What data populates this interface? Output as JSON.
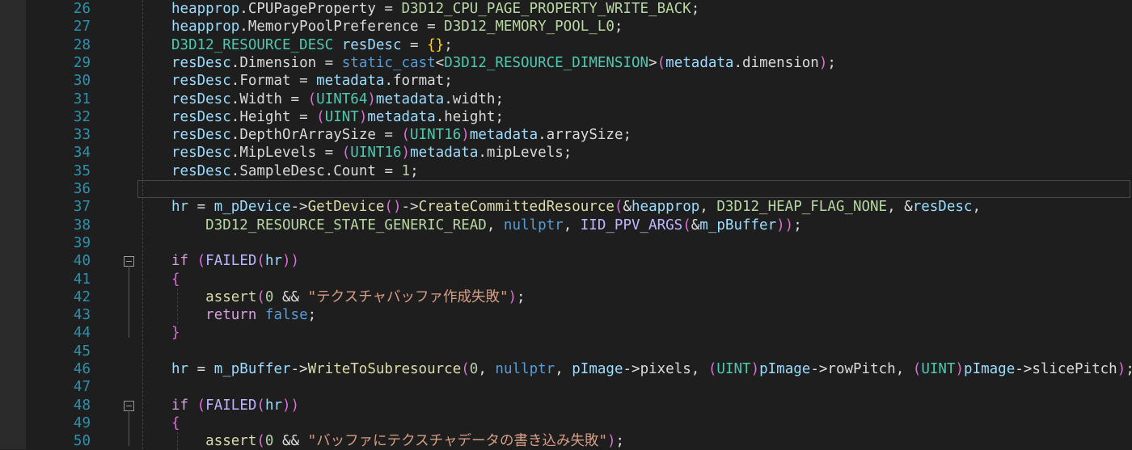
{
  "editor": {
    "line_numbers": [
      "26",
      "27",
      "28",
      "29",
      "30",
      "31",
      "32",
      "33",
      "34",
      "35",
      "36",
      "37",
      "38",
      "39",
      "40",
      "41",
      "42",
      "43",
      "44",
      "45",
      "46",
      "47",
      "48",
      "49",
      "50"
    ],
    "lines": [
      [
        [
          "t-var",
          "heapprop"
        ],
        [
          "t-plain",
          "."
        ],
        [
          "t-mem",
          "CPUPageProperty"
        ],
        [
          "t-plain",
          " = "
        ],
        [
          "t-enum",
          "D3D12_CPU_PAGE_PROPERTY_WRITE_BACK"
        ],
        [
          "t-plain",
          ";"
        ]
      ],
      [
        [
          "t-var",
          "heapprop"
        ],
        [
          "t-plain",
          "."
        ],
        [
          "t-mem",
          "MemoryPoolPreference"
        ],
        [
          "t-plain",
          " = "
        ],
        [
          "t-enum",
          "D3D12_MEMORY_POOL_L0"
        ],
        [
          "t-plain",
          ";"
        ]
      ],
      [
        [
          "t-type",
          "D3D12_RESOURCE_DESC"
        ],
        [
          "t-plain",
          " "
        ],
        [
          "t-var",
          "resDesc"
        ],
        [
          "t-plain",
          " = "
        ],
        [
          "t-brace",
          "{}"
        ],
        [
          "t-plain",
          ";"
        ]
      ],
      [
        [
          "t-var",
          "resDesc"
        ],
        [
          "t-plain",
          "."
        ],
        [
          "t-mem",
          "Dimension"
        ],
        [
          "t-plain",
          " = "
        ],
        [
          "t-kw",
          "static_cast"
        ],
        [
          "t-plain",
          "<"
        ],
        [
          "t-type",
          "D3D12_RESOURCE_DIMENSION"
        ],
        [
          "t-plain",
          ">"
        ],
        [
          "t-paren",
          "("
        ],
        [
          "t-var",
          "metadata"
        ],
        [
          "t-plain",
          "."
        ],
        [
          "t-mem",
          "dimension"
        ],
        [
          "t-paren",
          ")"
        ],
        [
          "t-plain",
          ";"
        ]
      ],
      [
        [
          "t-var",
          "resDesc"
        ],
        [
          "t-plain",
          "."
        ],
        [
          "t-mem",
          "Format"
        ],
        [
          "t-plain",
          " = "
        ],
        [
          "t-var",
          "metadata"
        ],
        [
          "t-plain",
          "."
        ],
        [
          "t-mem",
          "format"
        ],
        [
          "t-plain",
          ";"
        ]
      ],
      [
        [
          "t-var",
          "resDesc"
        ],
        [
          "t-plain",
          "."
        ],
        [
          "t-mem",
          "Width"
        ],
        [
          "t-plain",
          " = "
        ],
        [
          "t-paren",
          "("
        ],
        [
          "t-type",
          "UINT64"
        ],
        [
          "t-paren",
          ")"
        ],
        [
          "t-var",
          "metadata"
        ],
        [
          "t-plain",
          "."
        ],
        [
          "t-mem",
          "width"
        ],
        [
          "t-plain",
          ";"
        ]
      ],
      [
        [
          "t-var",
          "resDesc"
        ],
        [
          "t-plain",
          "."
        ],
        [
          "t-mem",
          "Height"
        ],
        [
          "t-plain",
          " = "
        ],
        [
          "t-paren",
          "("
        ],
        [
          "t-type",
          "UINT"
        ],
        [
          "t-paren",
          ")"
        ],
        [
          "t-var",
          "metadata"
        ],
        [
          "t-plain",
          "."
        ],
        [
          "t-mem",
          "height"
        ],
        [
          "t-plain",
          ";"
        ]
      ],
      [
        [
          "t-var",
          "resDesc"
        ],
        [
          "t-plain",
          "."
        ],
        [
          "t-mem",
          "DepthOrArraySize"
        ],
        [
          "t-plain",
          " = "
        ],
        [
          "t-paren",
          "("
        ],
        [
          "t-type",
          "UINT16"
        ],
        [
          "t-paren",
          ")"
        ],
        [
          "t-var",
          "metadata"
        ],
        [
          "t-plain",
          "."
        ],
        [
          "t-mem",
          "arraySize"
        ],
        [
          "t-plain",
          ";"
        ]
      ],
      [
        [
          "t-var",
          "resDesc"
        ],
        [
          "t-plain",
          "."
        ],
        [
          "t-mem",
          "MipLevels"
        ],
        [
          "t-plain",
          " = "
        ],
        [
          "t-paren",
          "("
        ],
        [
          "t-type",
          "UINT16"
        ],
        [
          "t-paren",
          ")"
        ],
        [
          "t-var",
          "metadata"
        ],
        [
          "t-plain",
          "."
        ],
        [
          "t-mem",
          "mipLevels"
        ],
        [
          "t-plain",
          ";"
        ]
      ],
      [
        [
          "t-var",
          "resDesc"
        ],
        [
          "t-plain",
          "."
        ],
        [
          "t-mem",
          "SampleDesc"
        ],
        [
          "t-plain",
          "."
        ],
        [
          "t-mem",
          "Count"
        ],
        [
          "t-plain",
          " = "
        ],
        [
          "t-num",
          "1"
        ],
        [
          "t-plain",
          ";"
        ]
      ],
      [],
      [
        [
          "t-var",
          "hr"
        ],
        [
          "t-plain",
          " = "
        ],
        [
          "t-var",
          "m_pDevice"
        ],
        [
          "t-plain",
          "->"
        ],
        [
          "t-fn",
          "GetDevice"
        ],
        [
          "t-paren",
          "()"
        ],
        [
          "t-plain",
          "->"
        ],
        [
          "t-fn",
          "CreateCommittedResource"
        ],
        [
          "t-paren",
          "("
        ],
        [
          "t-plain",
          "&"
        ],
        [
          "t-var",
          "heapprop"
        ],
        [
          "t-plain",
          ", "
        ],
        [
          "t-enum",
          "D3D12_HEAP_FLAG_NONE"
        ],
        [
          "t-plain",
          ", &"
        ],
        [
          "t-var",
          "resDesc"
        ],
        [
          "t-plain",
          ","
        ]
      ],
      [
        [
          "t-plain",
          "    "
        ],
        [
          "t-enum",
          "D3D12_RESOURCE_STATE_GENERIC_READ"
        ],
        [
          "t-plain",
          ", "
        ],
        [
          "t-kw",
          "nullptr"
        ],
        [
          "t-plain",
          ", "
        ],
        [
          "t-macro",
          "IID_PPV_ARGS"
        ],
        [
          "t-paren",
          "("
        ],
        [
          "t-plain",
          "&"
        ],
        [
          "t-var",
          "m_pBuffer"
        ],
        [
          "t-paren",
          "))"
        ],
        [
          "t-plain",
          ";"
        ]
      ],
      [],
      [
        [
          "t-ctrl",
          "if"
        ],
        [
          "t-plain",
          " "
        ],
        [
          "t-paren",
          "("
        ],
        [
          "t-macro",
          "FAILED"
        ],
        [
          "t-paren",
          "("
        ],
        [
          "t-var",
          "hr"
        ],
        [
          "t-paren",
          "))"
        ]
      ],
      [
        [
          "t-brace2",
          "{"
        ]
      ],
      [
        [
          "t-plain",
          "    "
        ],
        [
          "t-fn",
          "assert"
        ],
        [
          "t-paren",
          "("
        ],
        [
          "t-num",
          "0"
        ],
        [
          "t-plain",
          " && "
        ],
        [
          "t-str",
          "\"テクスチャバッファ作成失敗\""
        ],
        [
          "t-paren",
          ")"
        ],
        [
          "t-plain",
          ";"
        ]
      ],
      [
        [
          "t-plain",
          "    "
        ],
        [
          "t-ctrl",
          "return"
        ],
        [
          "t-plain",
          " "
        ],
        [
          "t-kw",
          "false"
        ],
        [
          "t-plain",
          ";"
        ]
      ],
      [
        [
          "t-brace2",
          "}"
        ]
      ],
      [],
      [
        [
          "t-var",
          "hr"
        ],
        [
          "t-plain",
          " = "
        ],
        [
          "t-var",
          "m_pBuffer"
        ],
        [
          "t-plain",
          "->"
        ],
        [
          "t-fn",
          "WriteToSubresource"
        ],
        [
          "t-paren",
          "("
        ],
        [
          "t-num",
          "0"
        ],
        [
          "t-plain",
          ", "
        ],
        [
          "t-kw",
          "nullptr"
        ],
        [
          "t-plain",
          ", "
        ],
        [
          "t-var",
          "pImage"
        ],
        [
          "t-plain",
          "->"
        ],
        [
          "t-mem",
          "pixels"
        ],
        [
          "t-plain",
          ", "
        ],
        [
          "t-paren",
          "("
        ],
        [
          "t-type",
          "UINT"
        ],
        [
          "t-paren",
          ")"
        ],
        [
          "t-var",
          "pImage"
        ],
        [
          "t-plain",
          "->"
        ],
        [
          "t-mem",
          "rowPitch"
        ],
        [
          "t-plain",
          ", "
        ],
        [
          "t-paren",
          "("
        ],
        [
          "t-type",
          "UINT"
        ],
        [
          "t-paren",
          ")"
        ],
        [
          "t-var",
          "pImage"
        ],
        [
          "t-plain",
          "->"
        ],
        [
          "t-mem",
          "slicePitch"
        ],
        [
          "t-paren",
          ")"
        ],
        [
          "t-plain",
          ";"
        ]
      ],
      [],
      [
        [
          "t-ctrl",
          "if"
        ],
        [
          "t-plain",
          " "
        ],
        [
          "t-paren",
          "("
        ],
        [
          "t-macro",
          "FAILED"
        ],
        [
          "t-paren",
          "("
        ],
        [
          "t-var",
          "hr"
        ],
        [
          "t-paren",
          "))"
        ]
      ],
      [
        [
          "t-brace2",
          "{"
        ]
      ],
      [
        [
          "t-plain",
          "    "
        ],
        [
          "t-fn",
          "assert"
        ],
        [
          "t-paren",
          "("
        ],
        [
          "t-num",
          "0"
        ],
        [
          "t-plain",
          " && "
        ],
        [
          "t-str",
          "\"バッファにテクスチャデータの書き込み失敗\""
        ],
        [
          "t-paren",
          ")"
        ],
        [
          "t-plain",
          ";"
        ]
      ]
    ],
    "fold_lines": [
      "40",
      "48"
    ],
    "current_line": "36",
    "colors": {
      "background": "#1e1e1e",
      "line_number": "#2b91af",
      "keyword": "#569cd6",
      "type": "#4ec9b0",
      "enum": "#b8d7a3",
      "function": "#dcdcaa",
      "string": "#d69d85",
      "macro": "#beb7ff"
    }
  }
}
